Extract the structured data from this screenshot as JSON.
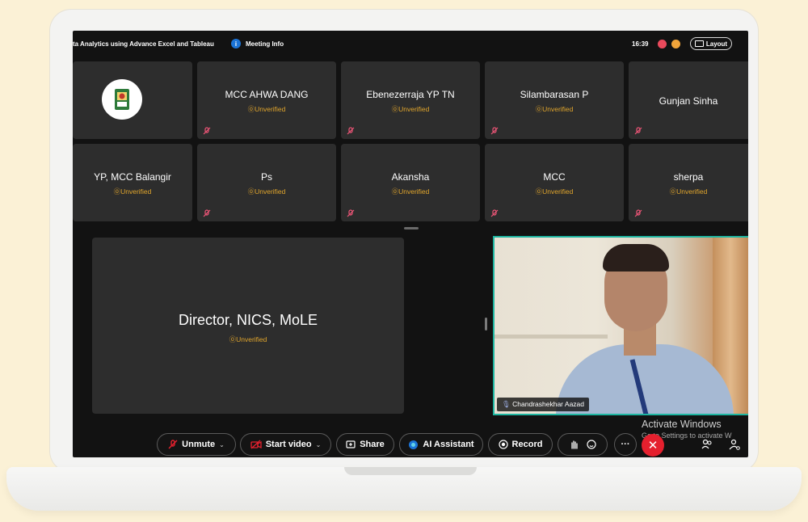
{
  "topbar": {
    "meeting_title": "ta Analytics using Advance Excel and Tableau",
    "meeting_info_label": "Meeting Info",
    "time": "16:39",
    "layout_label": "Layout"
  },
  "participants_row1": [
    {
      "name": "",
      "status": "",
      "is_logo": true
    },
    {
      "name": "MCC AHWA DANG",
      "status": "⓪Unverified"
    },
    {
      "name": "Ebenezerraja YP TN",
      "status": "⓪Unverified"
    },
    {
      "name": "Silambarasan P",
      "status": "⓪Unverified"
    },
    {
      "name": "Gunjan Sinha",
      "status": ""
    }
  ],
  "participants_row2": [
    {
      "name": "YP, MCC Balangir",
      "status": "⓪Unverified"
    },
    {
      "name": "Ps",
      "status": "⓪Unverified"
    },
    {
      "name": "Akansha",
      "status": "⓪Unverified"
    },
    {
      "name": "MCC",
      "status": "⓪Unverified"
    },
    {
      "name": "sherpa",
      "status": "⓪Unverified"
    }
  ],
  "main_speaker": {
    "name": "Director, NICS, MoLE",
    "status": "⓪Unverified"
  },
  "video_participant": {
    "name": "Chandrashekhar Aazad"
  },
  "controls": {
    "unmute": "Unmute",
    "start_video": "Start video",
    "share": "Share",
    "ai_assistant": "AI Assistant",
    "record": "Record",
    "more": "···",
    "end": "✕"
  },
  "watermark": {
    "title": "Activate Windows",
    "subtitle": "Go to Settings to activate W"
  },
  "colors": {
    "accent_teal": "#1db5a0",
    "unverified": "#e0a52d",
    "end_red": "#e5202e",
    "tile_bg": "#2d2d2d"
  }
}
